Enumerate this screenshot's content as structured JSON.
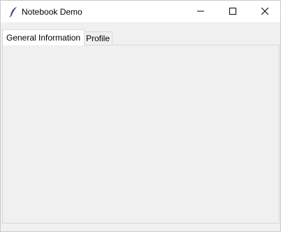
{
  "window": {
    "title": "Notebook Demo",
    "icon": "feather-icon",
    "controls": [
      "minimize-icon",
      "maximize-icon",
      "close-icon"
    ]
  },
  "notebook": {
    "tabs": [
      {
        "label": "General Information",
        "selected": true
      },
      {
        "label": "Profile",
        "selected": false
      }
    ]
  },
  "colors": {
    "titlebar": "#ffffff",
    "background": "#f0f0f0",
    "tab_border": "#d9d9d9"
  }
}
